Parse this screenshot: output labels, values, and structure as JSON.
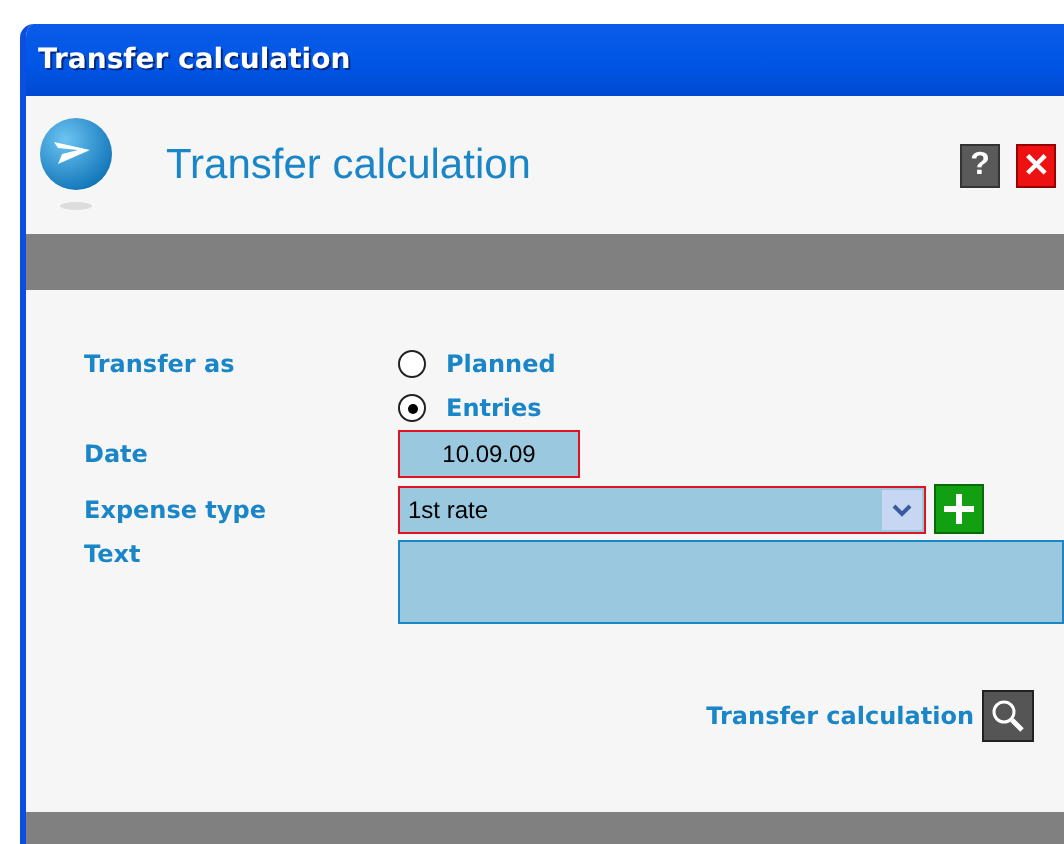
{
  "window": {
    "title": "Transfer calculation"
  },
  "header": {
    "title": "Transfer calculation",
    "help": "?",
    "close": "✕"
  },
  "form": {
    "transfer_as": {
      "label": "Transfer as",
      "options": [
        {
          "label": "Planned",
          "selected": false
        },
        {
          "label": "Entries",
          "selected": true
        }
      ]
    },
    "date": {
      "label": "Date",
      "value": "10.09.09",
      "required": true
    },
    "expense_type": {
      "label": "Expense type",
      "value": "1st rate",
      "required": true
    },
    "text": {
      "label": "Text",
      "required": false
    }
  },
  "action": {
    "label": "Transfer calculation"
  }
}
